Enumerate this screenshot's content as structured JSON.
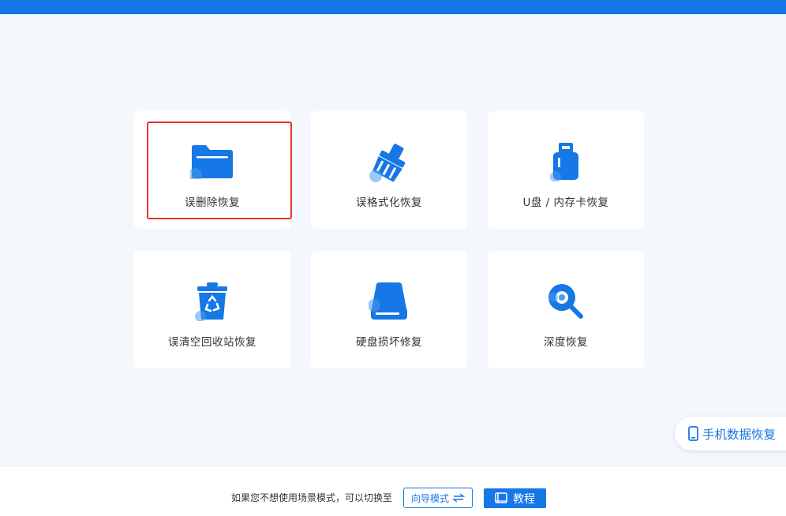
{
  "colors": {
    "primary": "#1677e6",
    "selection": "#e5322d",
    "background": "#f4f8fd"
  },
  "cards": [
    {
      "label": "误删除恢复",
      "icon": "folder-icon",
      "selected": true
    },
    {
      "label": "误格式化恢复",
      "icon": "broom-icon",
      "selected": false
    },
    {
      "label": "U盘 / 内存卡恢复",
      "icon": "usb-drive-icon",
      "selected": false
    },
    {
      "label": "误清空回收站恢复",
      "icon": "recycle-bin-icon",
      "selected": false
    },
    {
      "label": "硬盘损坏修复",
      "icon": "hard-drive-icon",
      "selected": false
    },
    {
      "label": "深度恢复",
      "icon": "deep-scan-icon",
      "selected": false
    }
  ],
  "phone_recovery": {
    "label": "手机数据恢复",
    "icon": "phone-icon"
  },
  "footer": {
    "hint": "如果您不想使用场景模式，可以切换至",
    "guide_label": "向导模式",
    "guide_icon": "swap-arrows-icon",
    "tutorial_label": "教程",
    "tutorial_icon": "book-icon"
  }
}
